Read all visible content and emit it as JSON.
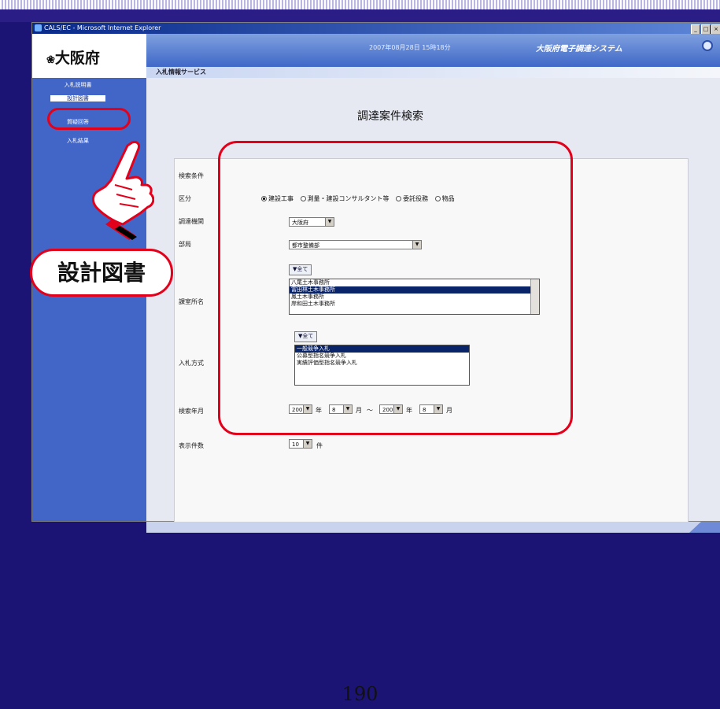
{
  "window": {
    "title": "CALS/EC - Microsoft Internet Explorer",
    "controls": [
      "_",
      "□",
      "×"
    ]
  },
  "header": {
    "logo": "大阪府",
    "datetime": "2007年08月28日 15時18分",
    "system_name": "大阪府電子調達システム",
    "service_name": "入札情報サービス"
  },
  "nav": {
    "items": [
      {
        "label": "入札説明書"
      },
      {
        "label": "設計図書"
      },
      {
        "label": "質疑回答"
      },
      {
        "label": "入札結果"
      }
    ]
  },
  "form": {
    "page_title": "調達案件検索",
    "conditions_label": "検索条件",
    "category": {
      "label": "区分",
      "options": [
        "建設工事",
        "測量・建設コンサルタント等",
        "委託役務",
        "物品"
      ],
      "selected": "建設工事"
    },
    "procuring_agency": {
      "label": "調達機関",
      "value": "大阪府"
    },
    "department": {
      "label": "部局",
      "value": "都市整備部"
    },
    "office": {
      "label": "課室所名",
      "all_button": "▼全て",
      "options": [
        "八尾土木事務所",
        "富田林土木事務所",
        "鳳土木事務所",
        "岸和田土木事務所"
      ],
      "selected": "富田林土木事務所"
    },
    "bid_method": {
      "label": "入札方式",
      "all_button": "▼全て",
      "options": [
        "一般競争入札",
        "公募型指名競争入札",
        "実績評価型指名競争入札"
      ],
      "selected": "一般競争入札"
    },
    "search_period": {
      "label": "検索年月",
      "from_year": "2007",
      "from_month": "8",
      "to_year": "2007",
      "to_month": "8",
      "year_suffix": "年",
      "month_suffix": "月",
      "separator": "〜"
    },
    "display_count": {
      "label": "表示件数",
      "value": "10",
      "suffix": "件"
    }
  },
  "callout": {
    "text": "設計図書"
  },
  "page_number": "190",
  "colors": {
    "accent": "#e3001b",
    "nav": "#4266c7",
    "slide_bg": "#1c1474"
  }
}
